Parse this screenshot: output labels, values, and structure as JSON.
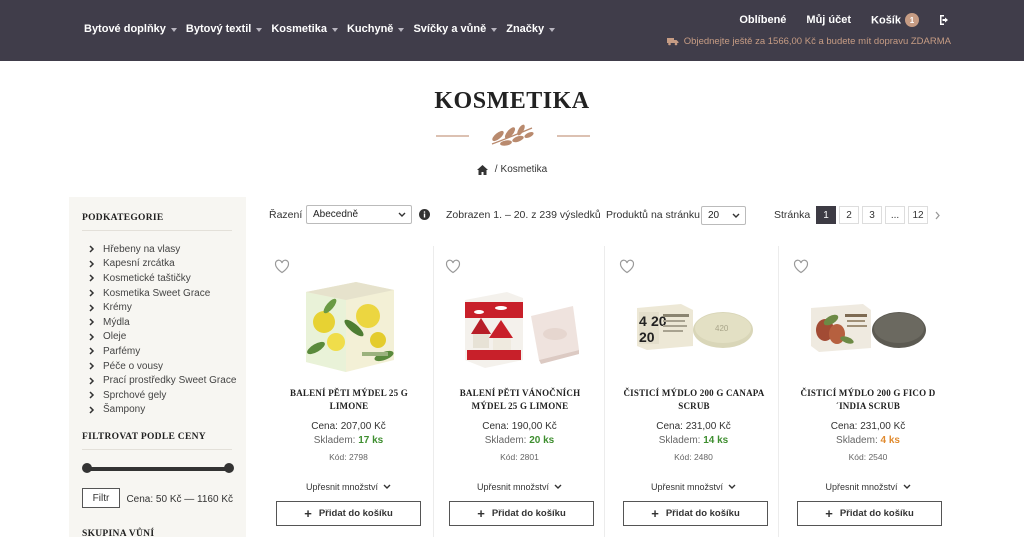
{
  "nav": {
    "items": [
      {
        "label": "Bytové doplňky"
      },
      {
        "label": "Bytový textil"
      },
      {
        "label": "Kosmetika"
      },
      {
        "label": "Kuchyně"
      },
      {
        "label": "Svíčky a vůně"
      },
      {
        "label": "Značky"
      }
    ],
    "favorites": "Oblíbené",
    "account": "Můj účet",
    "cart": "Košík",
    "cart_count": "1",
    "shipping_notice": "Objednejte ještě za 1566,00 Kč a budete mít dopravu ZDARMA"
  },
  "page": {
    "title": "KOSMETIKA",
    "breadcrumb_sep": "/",
    "breadcrumb_current": "Kosmetika"
  },
  "sidebar": {
    "subcategories_heading": "PODKATEGORIE",
    "subcategories": [
      "Hřebeny na vlasy",
      "Kapesní zrcátka",
      "Kosmetické taštičky",
      "Kosmetika Sweet Grace",
      "Krémy",
      "Mýdla",
      "Oleje",
      "Parfémy",
      "Péče o vousy",
      "Prací prostředky Sweet Grace",
      "Sprchové gely",
      "Šampony"
    ],
    "price_filter_heading": "FILTROVAT PODLE CENY",
    "filter_button": "Filtr",
    "price_range": "Cena: 50 Kč — 1160 Kč",
    "scent_group_heading": "SKUPINA VŮNÍ"
  },
  "toolbar": {
    "sort_label": "Řazení",
    "sort_value": "Abecedně",
    "results_text": "Zobrazen 1. – 20. z 239 výsledků",
    "per_page_label": "Produktů na stránku",
    "per_page_value": "20",
    "page_label": "Stránka",
    "pages": [
      "1",
      "2",
      "3",
      "...",
      "12"
    ],
    "current_page": "1"
  },
  "products": [
    {
      "name": "BALENÍ PĚTI MÝDEL 25 G LIMONE",
      "price": "Cena: 207,00 Kč",
      "stock_label": "Skladem:",
      "stock_qty": "17 ks",
      "stock_color": "#3e8e2f",
      "code": "Kód: 2798",
      "refine": "Upřesnit množství",
      "add": "Přidat do košíku"
    },
    {
      "name": "BALENÍ PĚTI VÁNOČNÍCH MÝDEL 25 G LIMONE",
      "price": "Cena: 190,00 Kč",
      "stock_label": "Skladem:",
      "stock_qty": "20 ks",
      "stock_color": "#3e8e2f",
      "code": "Kód: 2801",
      "refine": "Upřesnit množství",
      "add": "Přidat do košíku"
    },
    {
      "name": "ČISTICÍ MÝDLO 200 G CANAPA SCRUB",
      "price": "Cena: 231,00 Kč",
      "stock_label": "Skladem:",
      "stock_qty": "14 ks",
      "stock_color": "#3e8e2f",
      "code": "Kód: 2480",
      "refine": "Upřesnit množství",
      "add": "Přidat do košíku"
    },
    {
      "name": "ČISTICÍ MÝDLO 200 G FICO D´INDIA SCRUB",
      "price": "Cena: 231,00 Kč",
      "stock_label": "Skladem:",
      "stock_qty": "4 ks",
      "stock_color": "#e08a2e",
      "code": "Kód: 2540",
      "refine": "Upřesnit množství",
      "add": "Přidat do košíku"
    }
  ],
  "colors": {
    "header_bg": "#403d4a",
    "accent": "#c69c84",
    "sidebar_bg": "#f7f6f2",
    "active_page": "#3d3b44"
  },
  "icons": [
    "caret-down-icon",
    "logout-icon",
    "truck-icon",
    "leaf-ornament-icon",
    "home-icon",
    "chevron-right-icon",
    "info-icon",
    "heart-icon",
    "plus-icon"
  ]
}
